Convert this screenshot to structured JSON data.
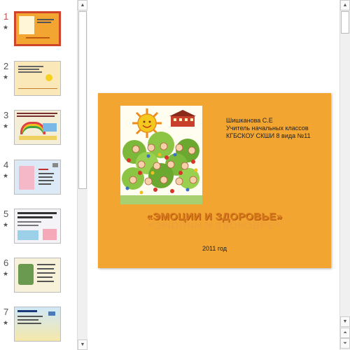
{
  "thumbnails": [
    {
      "number": "1",
      "star": "★",
      "selected": true
    },
    {
      "number": "2",
      "star": "★"
    },
    {
      "number": "3",
      "star": "★"
    },
    {
      "number": "4",
      "star": "★"
    },
    {
      "number": "5",
      "star": "★"
    },
    {
      "number": "6",
      "star": "★"
    },
    {
      "number": "7",
      "star": "★"
    }
  ],
  "slide": {
    "author_name": "Шишканова С.Е",
    "author_role": "Учитель начальных классов",
    "author_school": "КГБСКОУ СКШИ 8 вида №11",
    "title": "«ЭМОЦИИ И ЗДОРОВЬЕ»",
    "year": "2011 год"
  },
  "colors": {
    "slide_bg": "#f2a531",
    "title": "#d8791c",
    "selected_border": "#d0452a"
  }
}
